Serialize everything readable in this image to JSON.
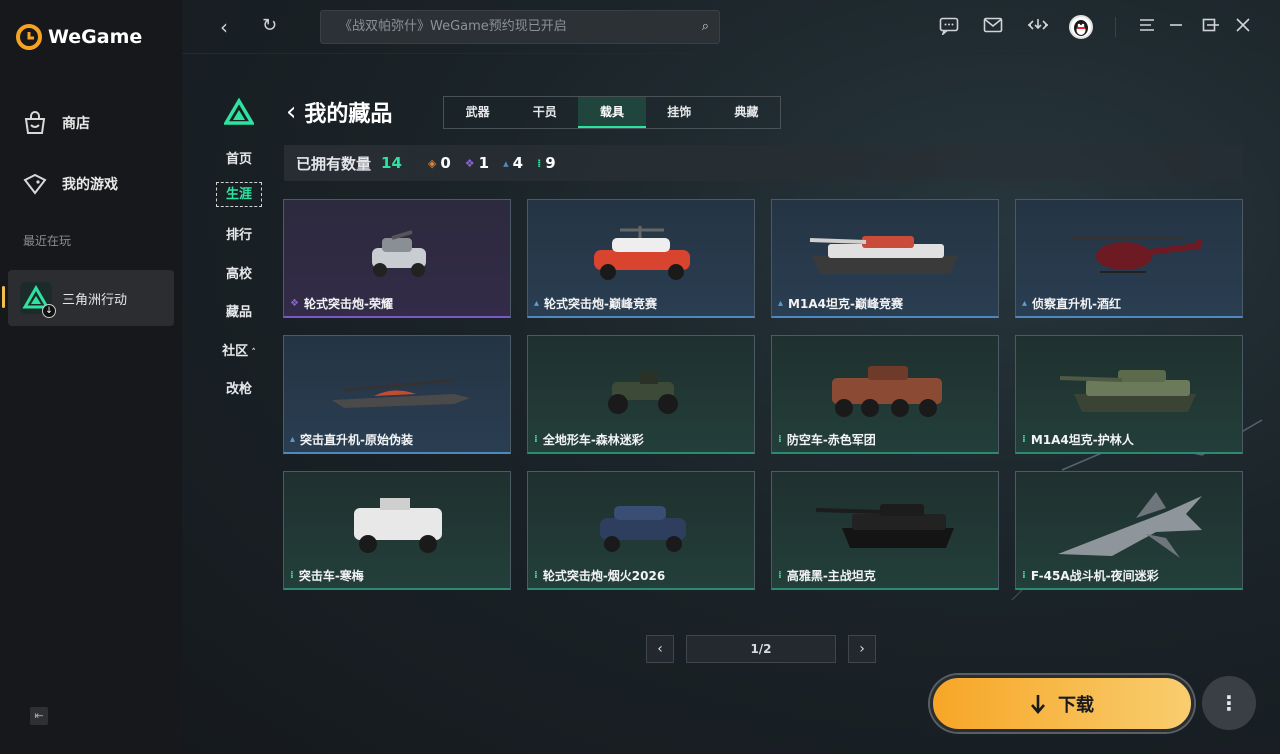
{
  "app": {
    "name": "WeGame"
  },
  "sidebar": {
    "items": [
      {
        "label": "商店",
        "icon": "bag-icon"
      },
      {
        "label": "我的游戏",
        "icon": "gamepad-icon"
      }
    ],
    "recent_label": "最近在玩",
    "recent_game": {
      "label": "三角洲行动"
    }
  },
  "topbar": {
    "search_placeholder": "《战双帕弥什》WeGame预约现已开启"
  },
  "game_nav": {
    "items": [
      "首页",
      "生涯",
      "排行",
      "高校",
      "藏品",
      "社区",
      "改枪"
    ],
    "active": "生涯"
  },
  "page": {
    "title": "我的藏品",
    "tabs": [
      "武器",
      "干员",
      "载具",
      "挂饰",
      "典藏"
    ],
    "active_tab": "载具",
    "stats": {
      "owned_label": "已拥有数量",
      "owned_total": "14",
      "orange": "0",
      "purple": "1",
      "blue": "4",
      "green": "9"
    },
    "cards": [
      {
        "label": "轮式突击炮-荣耀",
        "rarity": "purple",
        "kind": "car"
      },
      {
        "label": "轮式突击炮-巅峰竞赛",
        "rarity": "blue",
        "kind": "car-red"
      },
      {
        "label": "M1A4坦克-巅峰竞赛",
        "rarity": "blue",
        "kind": "tank-red"
      },
      {
        "label": "侦察直升机-酒红",
        "rarity": "blue",
        "kind": "heli-red"
      },
      {
        "label": "突击直升机-原始伪装",
        "rarity": "blue",
        "kind": "apache"
      },
      {
        "label": "全地形车-森林迷彩",
        "rarity": "green",
        "kind": "atv"
      },
      {
        "label": "防空车-赤色军团",
        "rarity": "green",
        "kind": "apc"
      },
      {
        "label": "M1A4坦克-护林人",
        "rarity": "green",
        "kind": "tank-camo"
      },
      {
        "label": "突击车-寒梅",
        "rarity": "green",
        "kind": "truck"
      },
      {
        "label": "轮式突击炮-烟火2026",
        "rarity": "green",
        "kind": "car-blue"
      },
      {
        "label": "高雅黑-主战坦克",
        "rarity": "green",
        "kind": "tank-black"
      },
      {
        "label": "F-45A战斗机-夜间迷彩",
        "rarity": "green",
        "kind": "jet"
      }
    ],
    "pagination": "1/2"
  },
  "download_label": "下载",
  "colors": {
    "accent": "#2ee3a0",
    "download": "#f7a626",
    "purple": "#8a62d8",
    "blue": "#4f88bf",
    "green": "#2c8a73"
  }
}
